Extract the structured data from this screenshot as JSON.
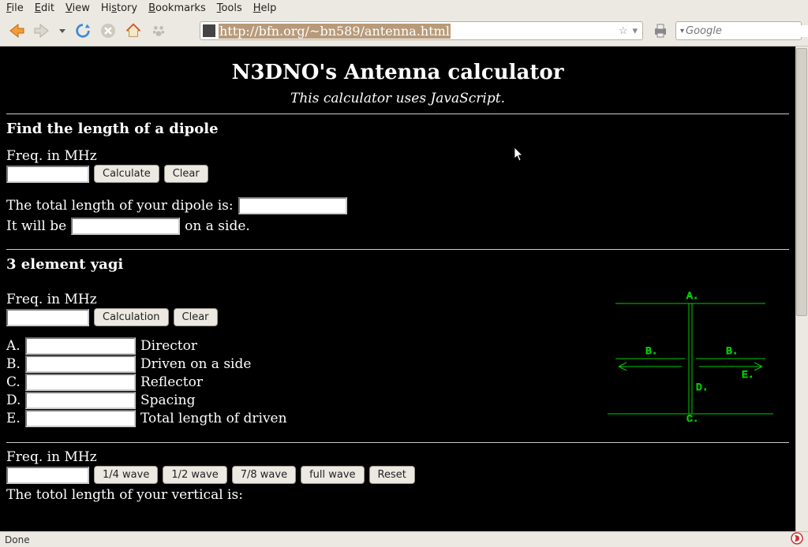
{
  "menubar": {
    "file": "File",
    "edit": "Edit",
    "view": "View",
    "history": "History",
    "bookmarks": "Bookmarks",
    "tools": "Tools",
    "help": "Help"
  },
  "toolbar": {
    "url": "http://bfn.org/~bn589/antenna.html",
    "search_placeholder": "Google"
  },
  "page": {
    "title": "N3DNO's Antenna calculator",
    "subtitle": "This calculator uses JavaScript.",
    "dipole": {
      "heading": "Find the length of a dipole",
      "freq_label": "Freq. in MHz",
      "calculate": "Calculate",
      "clear": "Clear",
      "total_prefix": "The total length of your dipole is:",
      "it_will_be": "It will be",
      "on_a_side": "on a side."
    },
    "yagi": {
      "heading": "3 element yagi",
      "freq_label": "Freq. in MHz",
      "calculation": "Calculation",
      "clear": "Clear",
      "rows": {
        "a": {
          "letter": "A.",
          "label": "Director"
        },
        "b": {
          "letter": "B.",
          "label": "Driven on a side"
        },
        "c": {
          "letter": "C.",
          "label": "Reflector"
        },
        "d": {
          "letter": "D.",
          "label": "Spacing"
        },
        "e": {
          "letter": "E.",
          "label": "Total length of driven"
        }
      },
      "diagram": {
        "A": "A.",
        "B": "B.",
        "C": "C.",
        "D": "D.",
        "E": "E."
      }
    },
    "vertical": {
      "freq_label": "Freq. in MHz",
      "q14": "1/4 wave",
      "q12": "1/2 wave",
      "q78": "7/8 wave",
      "full": "full wave",
      "reset": "Reset",
      "result_prefix": "The totol length of your vertical is:"
    }
  },
  "statusbar": {
    "left": "Done"
  }
}
